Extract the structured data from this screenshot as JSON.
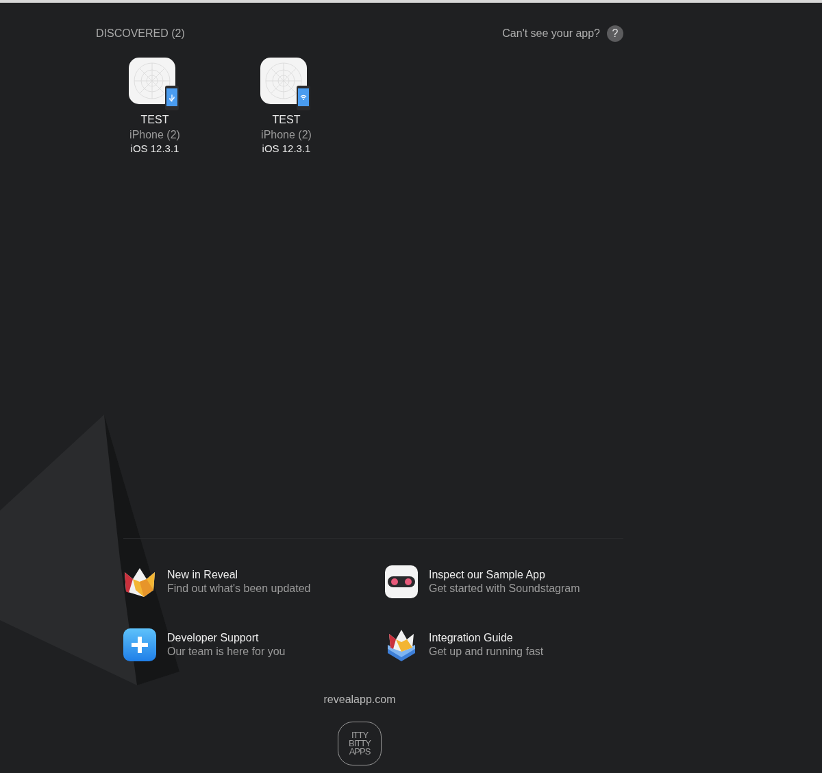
{
  "discovered": {
    "heading": "DISCOVERED (2)",
    "help_text": "Can't see your app?",
    "help_icon": "?"
  },
  "devices": [
    {
      "name": "TEST",
      "device": "iPhone (2)",
      "os": "iOS 12.3.1",
      "kind": "usb"
    },
    {
      "name": "TEST",
      "device": "iPhone (2)",
      "os": "iOS 12.3.1",
      "kind": "wifi"
    }
  ],
  "links": [
    {
      "title": "New in Reveal",
      "subtitle": "Find out what's been updated",
      "kind": "whats-new"
    },
    {
      "title": "Inspect our Sample App",
      "subtitle": "Get started with Soundstagram",
      "kind": "sample"
    },
    {
      "title": "Developer Support",
      "subtitle": "Our team is here for you",
      "kind": "support"
    },
    {
      "title": "Integration Guide",
      "subtitle": "Get up and running fast",
      "kind": "guide"
    }
  ],
  "website": "revealapp.com",
  "logo_lines": [
    "ITTY",
    "BITTY",
    "APPS"
  ]
}
